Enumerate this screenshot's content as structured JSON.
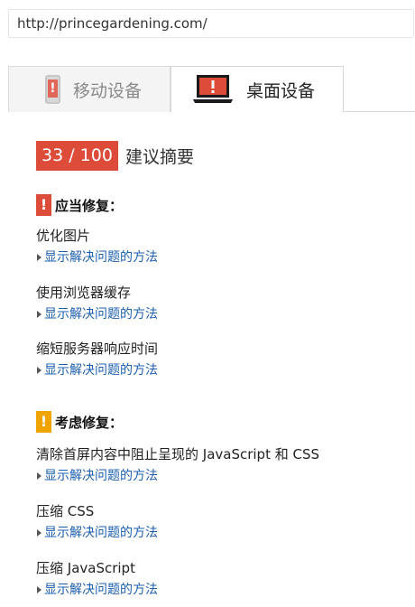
{
  "url": "http://princegardening.com/",
  "tabs": {
    "mobile_label": "移动设备",
    "desktop_label": "桌面设备"
  },
  "icons": {
    "phone": "phone-warning-icon",
    "desktop": "desktop-warning-icon"
  },
  "colors": {
    "error_red": "#dd4b39",
    "warning_orange": "#f0a400",
    "link_blue": "#1c5fb0"
  },
  "score": {
    "value": "33 / 100",
    "title": "建议摘要"
  },
  "should_fix": {
    "icon": "!",
    "label": "应当修复：",
    "rules": [
      {
        "title": "优化图片",
        "link": "显示解决问题的方法"
      },
      {
        "title": "使用浏览器缓存",
        "link": "显示解决问题的方法"
      },
      {
        "title": "缩短服务器响应时间",
        "link": "显示解决问题的方法"
      }
    ]
  },
  "consider_fixing": {
    "icon": "!",
    "label": "考虑修复：",
    "rules": [
      {
        "title": "清除首屏内容中阻止呈现的 JavaScript 和 CSS",
        "link": "显示解决问题的方法"
      },
      {
        "title": "压缩 CSS",
        "link": "显示解决问题的方法"
      },
      {
        "title": "压缩 JavaScript",
        "link": "显示解决问题的方法"
      }
    ]
  }
}
